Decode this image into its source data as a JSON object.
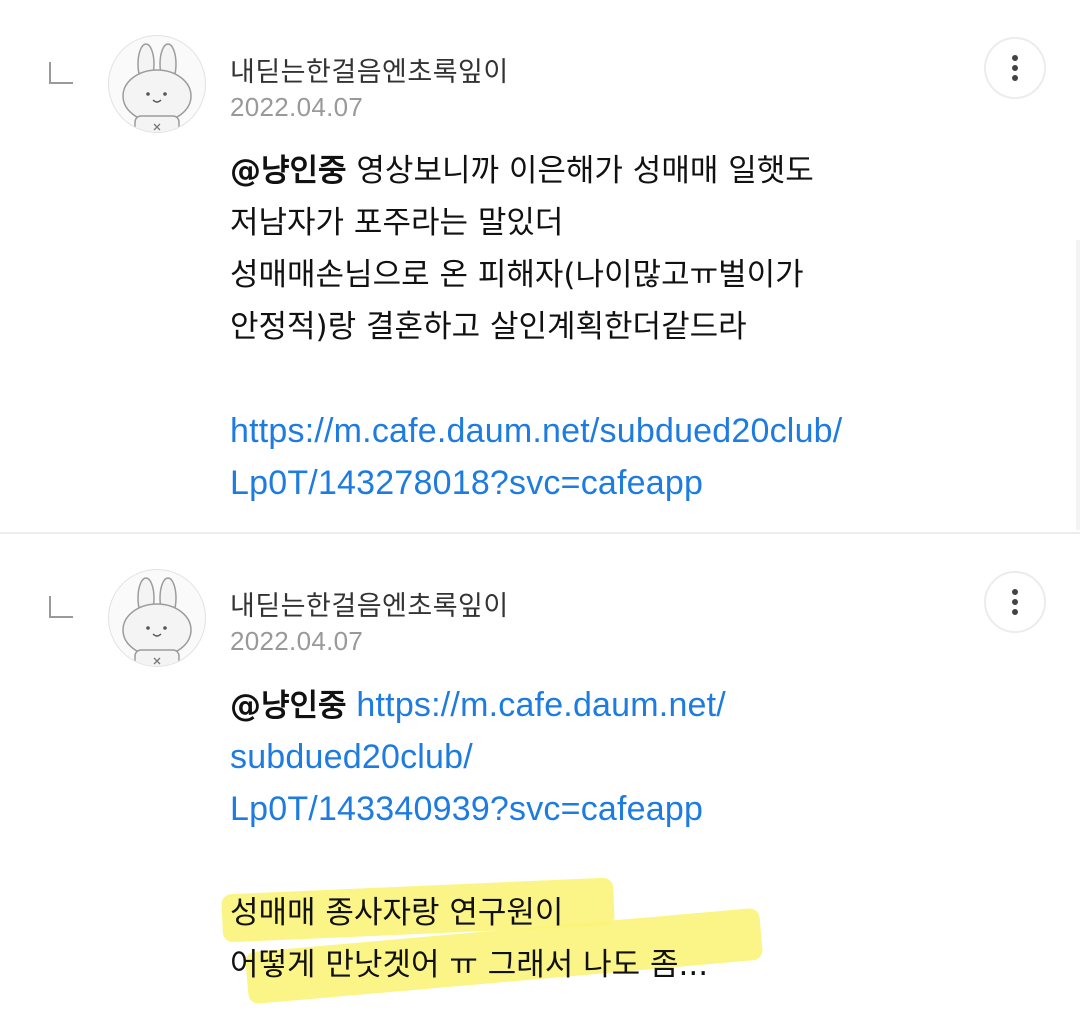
{
  "comments": [
    {
      "nickname": "내딛는한걸음엔초록잎이",
      "date": "2022.04.07",
      "mention": "@냥인중",
      "line1_rest": " 영상보니까 이은해가 성매매 일햇도",
      "line2": "저남자가 포주라는 말있더",
      "line3": "성매매손님으로 온 피해자(나이많고ㅠ벌이가",
      "line4": "안정적)랑 결혼하고 살인계획한더같드라",
      "link_line1": "https://m.cafe.daum.net/subdued20club/",
      "link_line2": "Lp0T/143278018?svc=cafeapp"
    },
    {
      "nickname": "내딛는한걸음엔초록잎이",
      "date": "2022.04.07",
      "mention": "@냥인중",
      "link_line1": "https://m.cafe.daum.net/",
      "link_line2": "subdued20club/",
      "link_line3": "Lp0T/143340939?svc=cafeapp",
      "line_a": "성매매 종사자랑 연구원이",
      "line_b": "어떻게 만낫겟어 ㅠ 그래서 나도 좀..."
    }
  ],
  "colors": {
    "link": "#1e7ce0",
    "highlight": "#fbf47a",
    "date": "#999999"
  },
  "icons": [
    "reply-icon",
    "rabbit-avatar-icon",
    "more-vertical-icon"
  ]
}
